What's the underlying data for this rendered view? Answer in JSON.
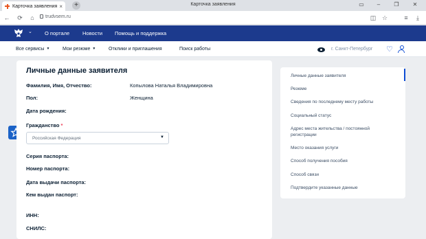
{
  "browser": {
    "tab_title": "Карточка заявления",
    "tab_close": "×",
    "new_tab": "+",
    "window_title": "Карточка заявления",
    "url": "trudvsem.ru"
  },
  "topnav": {
    "links": [
      "О портале",
      "Новости",
      "Помощь и поддержка"
    ]
  },
  "subnav": {
    "links": [
      "Все сервисы",
      "Мои резюме",
      "Отклики и приглашения",
      "Поиск работы"
    ],
    "city": "г. Санкт-Петербург"
  },
  "form": {
    "title": "Личные данные заявителя",
    "full_name_label": "Фамилия, Имя, Отчество:",
    "full_name_value": "Копылова Наталья Владимировна",
    "gender_label": "Пол:",
    "gender_value": "Женщина",
    "birth_label": "Дата рождения:",
    "citizenship_label": "Гражданство",
    "required_mark": "*",
    "citizenship_value": "Российская Федерация",
    "passport_series_label": "Серия паспорта:",
    "passport_number_label": "Номер паспорта:",
    "passport_date_label": "Дата выдачи паспорта:",
    "passport_issuer_label": "Кем выдан паспорт:",
    "inn_label": "ИНН:",
    "snils_label": "СНИЛС:"
  },
  "sidebar": {
    "items": [
      "Личные данные заявителя",
      "Резюме",
      "Сведения по последнему месту работы",
      "Социальный статус",
      "Адрес места жительства / постоянной регистрации",
      "Место оказания услуги",
      "Способ получения пособия",
      "Способ связи",
      "Подтвердите указанные данные"
    ]
  },
  "colors": {
    "brand_blue": "#1c3a8d",
    "accent": "#0d4cd3",
    "required": "#ee3f58"
  }
}
